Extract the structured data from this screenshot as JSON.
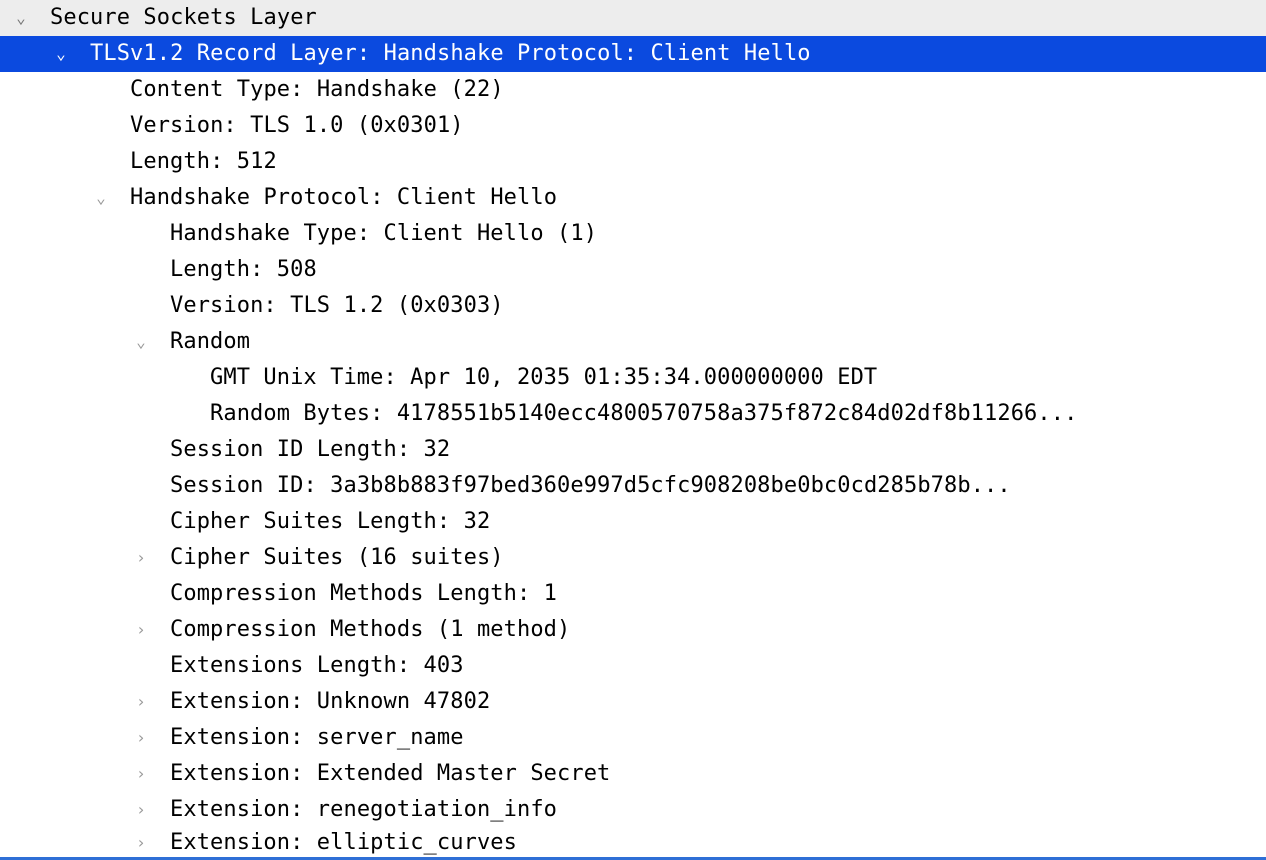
{
  "tree": {
    "ssl": {
      "label": "Secure Sockets Layer",
      "record": {
        "label": "TLSv1.2 Record Layer: Handshake Protocol: Client Hello",
        "content_type": "Content Type: Handshake (22)",
        "version": "Version: TLS 1.0 (0x0301)",
        "length": "Length: 512",
        "handshake": {
          "label": "Handshake Protocol: Client Hello",
          "type": "Handshake Type: Client Hello (1)",
          "length": "Length: 508",
          "version": "Version: TLS 1.2 (0x0303)",
          "random": {
            "label": "Random",
            "gmt": "GMT Unix Time: Apr 10, 2035 01:35:34.000000000 EDT",
            "bytes": "Random Bytes: 4178551b5140ecc4800570758a375f872c84d02df8b11266..."
          },
          "sid_len": "Session ID Length: 32",
          "sid": "Session ID: 3a3b8b883f97bed360e997d5cfc908208be0bc0cd285b78b...",
          "cs_len": "Cipher Suites Length: 32",
          "cs": "Cipher Suites (16 suites)",
          "cm_len": "Compression Methods Length: 1",
          "cm": "Compression Methods (1 method)",
          "ext_len": "Extensions Length: 403",
          "ext_unknown": "Extension: Unknown 47802",
          "ext_sni": "Extension: server_name",
          "ext_ems": "Extension: Extended Master Secret",
          "ext_reneg": "Extension: renegotiation_info",
          "ext_ec": "Extension: elliptic_curves"
        }
      }
    }
  }
}
